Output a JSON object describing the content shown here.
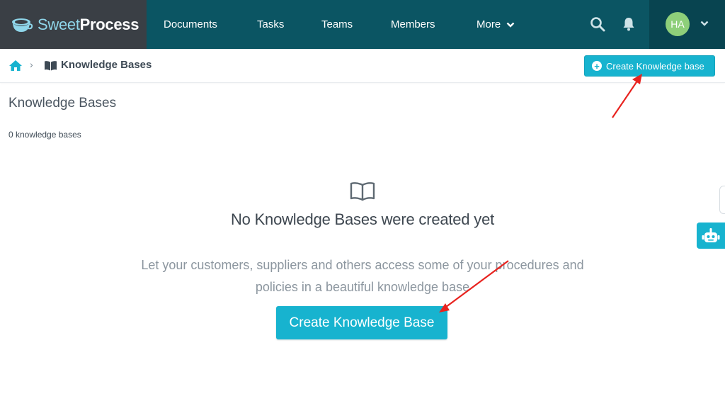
{
  "brand": {
    "name_light": "Sweet",
    "name_bold": "Process"
  },
  "nav": {
    "items": [
      {
        "label": "Documents"
      },
      {
        "label": "Tasks"
      },
      {
        "label": "Teams"
      },
      {
        "label": "Members"
      },
      {
        "label": "More"
      }
    ],
    "icons": [
      "search-icon",
      "bell-icon"
    ],
    "user": {
      "initials": "HA",
      "avatar_color": "#8ecf7a"
    }
  },
  "breadcrumb": {
    "separator": "›",
    "current": "Knowledge Bases"
  },
  "actions": {
    "create_top_label": "Create Knowledge base",
    "create_main_label": "Create Knowledge Base"
  },
  "content": {
    "title": "Knowledge Bases",
    "count": "0 knowledge bases",
    "empty_title": "No Knowledge Bases were created yet",
    "empty_description": "Let your customers, suppliers and others access some of your procedures and policies in a beautiful knowledge base"
  },
  "colors": {
    "nav_bg": "#0b5563",
    "brand_bg": "#3a3f45",
    "accent": "#17b3cf",
    "annotation": "#e8231f"
  }
}
